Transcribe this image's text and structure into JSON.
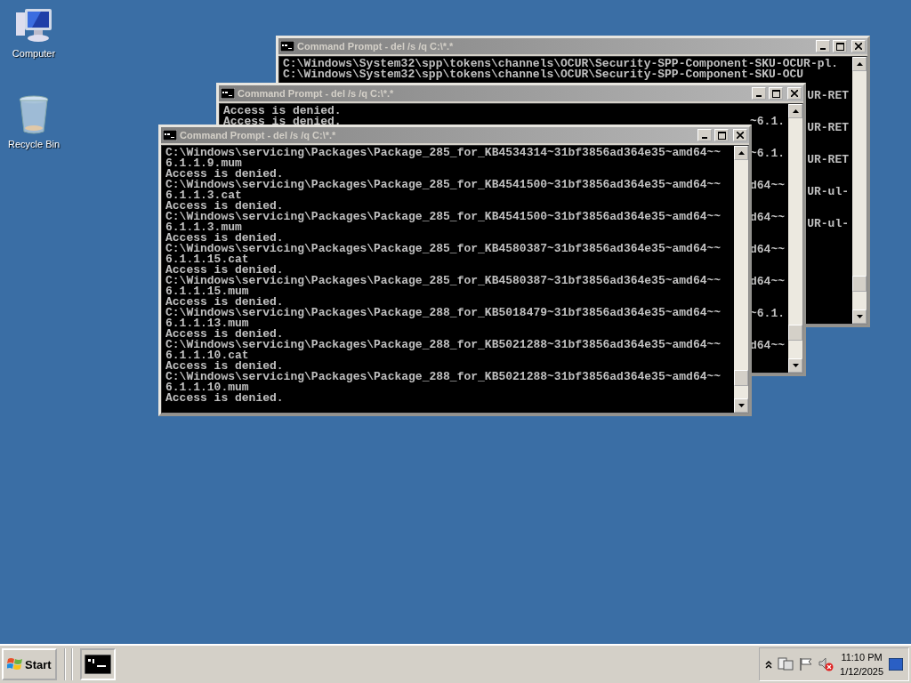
{
  "desktop_icons": [
    {
      "kind": "computer",
      "label": "Computer"
    },
    {
      "kind": "recycle-bin",
      "label": "Recycle Bin"
    }
  ],
  "windows": [
    {
      "title": "Command Prompt - del  /s /q C:\\*.*",
      "lines": [
        {
          "kind": "text",
          "left": "C:\\Windows\\System32\\spp\\tokens\\channels\\OCUR\\Security-SPP-Component-SKU-OCUR-pl."
        },
        {
          "kind": "text",
          "left": "C:\\Windows\\System32\\spp\\tokens\\channels\\OCUR\\Security-SPP-Component-SKU-OCU"
        },
        {
          "kind": "blank"
        },
        {
          "kind": "text",
          "right": "UR-RET"
        },
        {
          "kind": "blank"
        },
        {
          "kind": "blank"
        },
        {
          "kind": "text",
          "right": "UR-RET"
        },
        {
          "kind": "blank"
        },
        {
          "kind": "blank"
        },
        {
          "kind": "text",
          "right": "UR-RET"
        },
        {
          "kind": "blank"
        },
        {
          "kind": "blank"
        },
        {
          "kind": "text",
          "right": "UR-ul-"
        },
        {
          "kind": "blank"
        },
        {
          "kind": "blank"
        },
        {
          "kind": "text",
          "right": "UR-ul-"
        }
      ]
    },
    {
      "title": "Command Prompt - del  /s /q C:\\*.*",
      "lines": [
        {
          "kind": "text",
          "left": "Access is denied."
        },
        {
          "kind": "text",
          "left": "Access is denied.",
          "right": "~6.1."
        },
        {
          "kind": "blank"
        },
        {
          "kind": "blank"
        },
        {
          "kind": "text",
          "right": "~6.1."
        },
        {
          "kind": "blank"
        },
        {
          "kind": "blank"
        },
        {
          "kind": "text",
          "right": "d64~~"
        },
        {
          "kind": "blank"
        },
        {
          "kind": "blank"
        },
        {
          "kind": "text",
          "right": "d64~~"
        },
        {
          "kind": "blank"
        },
        {
          "kind": "blank"
        },
        {
          "kind": "text",
          "right": "d64~~"
        },
        {
          "kind": "blank"
        },
        {
          "kind": "blank"
        },
        {
          "kind": "text",
          "right": "d64~~"
        },
        {
          "kind": "blank"
        },
        {
          "kind": "blank"
        },
        {
          "kind": "text",
          "right": "~6.1."
        },
        {
          "kind": "blank"
        },
        {
          "kind": "blank"
        },
        {
          "kind": "text",
          "right": "d64~~"
        }
      ]
    },
    {
      "title": "Command Prompt - del  /s /q C:\\*.*",
      "lines": [
        {
          "kind": "text",
          "left": "C:\\Windows\\servicing\\Packages\\Package_285_for_KB4534314~31bf3856ad364e35~amd64~~"
        },
        {
          "kind": "text",
          "left": "6.1.1.9.mum"
        },
        {
          "kind": "text",
          "left": "Access is denied."
        },
        {
          "kind": "text",
          "left": "C:\\Windows\\servicing\\Packages\\Package_285_for_KB4541500~31bf3856ad364e35~amd64~~"
        },
        {
          "kind": "text",
          "left": "6.1.1.3.cat"
        },
        {
          "kind": "text",
          "left": "Access is denied."
        },
        {
          "kind": "text",
          "left": "C:\\Windows\\servicing\\Packages\\Package_285_for_KB4541500~31bf3856ad364e35~amd64~~"
        },
        {
          "kind": "text",
          "left": "6.1.1.3.mum"
        },
        {
          "kind": "text",
          "left": "Access is denied."
        },
        {
          "kind": "text",
          "left": "C:\\Windows\\servicing\\Packages\\Package_285_for_KB4580387~31bf3856ad364e35~amd64~~"
        },
        {
          "kind": "text",
          "left": "6.1.1.15.cat"
        },
        {
          "kind": "text",
          "left": "Access is denied."
        },
        {
          "kind": "text",
          "left": "C:\\Windows\\servicing\\Packages\\Package_285_for_KB4580387~31bf3856ad364e35~amd64~~"
        },
        {
          "kind": "text",
          "left": "6.1.1.15.mum"
        },
        {
          "kind": "text",
          "left": "Access is denied."
        },
        {
          "kind": "text",
          "left": "C:\\Windows\\servicing\\Packages\\Package_288_for_KB5018479~31bf3856ad364e35~amd64~~"
        },
        {
          "kind": "text",
          "left": "6.1.1.13.mum"
        },
        {
          "kind": "text",
          "left": "Access is denied."
        },
        {
          "kind": "text",
          "left": "C:\\Windows\\servicing\\Packages\\Package_288_for_KB5021288~31bf3856ad364e35~amd64~~"
        },
        {
          "kind": "text",
          "left": "6.1.1.10.cat"
        },
        {
          "kind": "text",
          "left": "Access is denied."
        },
        {
          "kind": "text",
          "left": "C:\\Windows\\servicing\\Packages\\Package_288_for_KB5021288~31bf3856ad364e35~amd64~~"
        },
        {
          "kind": "text",
          "left": "6.1.1.10.mum"
        },
        {
          "kind": "text",
          "left": "Access is denied."
        }
      ]
    }
  ],
  "taskbar": {
    "start_label": "Start",
    "clock": {
      "time": "11:10 PM",
      "date": "1/12/2025"
    }
  }
}
